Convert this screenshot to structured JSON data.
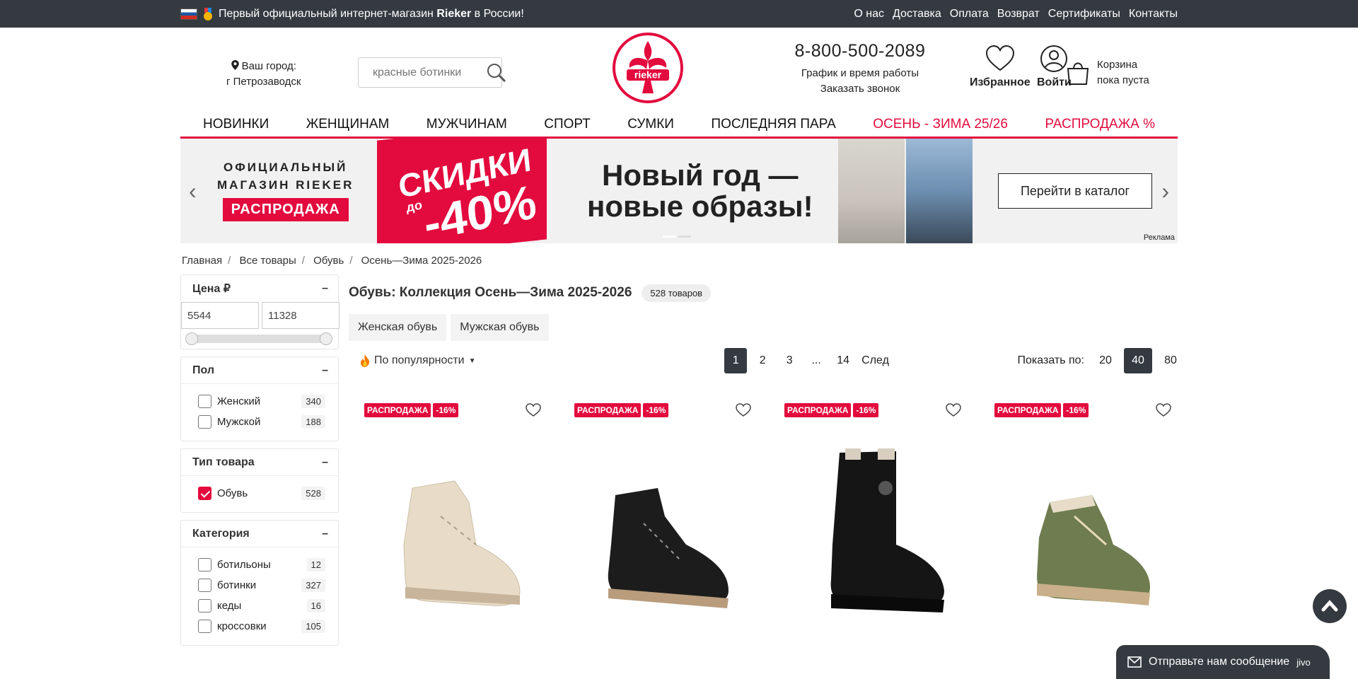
{
  "topbar": {
    "announcement_prefix": "Первый официальный интернет-магазин ",
    "announcement_brand": "Rieker",
    "announcement_suffix": " в России!",
    "links": [
      "О нас",
      "Доставка",
      "Оплата",
      "Возврат",
      "Сертификаты",
      "Контакты"
    ]
  },
  "header": {
    "city_label": "Ваш город:",
    "city_value": "г Петрозаводск",
    "search_placeholder": "красные ботинки",
    "logo_text": "rieker",
    "phone": "8-800-500-2089",
    "work_hours": "График и время работы",
    "callback": "Заказать звонок",
    "favorites": "Избранное",
    "login": "Войти",
    "cart_title": "Корзина",
    "cart_status": "пока пуста"
  },
  "nav": [
    "НОВИНКИ",
    "ЖЕНЩИНАМ",
    "МУЖЧИНАМ",
    "СПОРТ",
    "СУМКИ",
    "ПОСЛЕДНЯЯ ПАРА",
    "ОСЕНЬ - ЗИМА 25/26",
    "РАСПРОДАЖА %"
  ],
  "banner": {
    "line1": "ОФИЦИАЛЬНЫЙ",
    "line2": "МАГАЗИН RIEKER",
    "sale": "РАСПРОДАЖА",
    "discount_word": "СКИДКИ",
    "discount_prefix": "до",
    "discount_value": "-40%",
    "headline1": "Новый год —",
    "headline2": "новые образы!",
    "cta": "Перейти в каталог",
    "ad_label": "Реклама"
  },
  "breadcrumbs": [
    "Главная",
    "Все товары",
    "Обувь",
    "Осень—Зима 2025-2026"
  ],
  "filters": {
    "price": {
      "title": "Цена ₽",
      "min": "5544",
      "max": "11328"
    },
    "gender": {
      "title": "Пол",
      "items": [
        {
          "label": "Женский",
          "count": "340"
        },
        {
          "label": "Мужской",
          "count": "188"
        }
      ]
    },
    "type": {
      "title": "Тип товара",
      "items": [
        {
          "label": "Обувь",
          "count": "528"
        }
      ]
    },
    "category": {
      "title": "Категория",
      "items": [
        {
          "label": "ботильоны",
          "count": "12"
        },
        {
          "label": "ботинки",
          "count": "327"
        },
        {
          "label": "кеды",
          "count": "16"
        },
        {
          "label": "кроссовки",
          "count": "105"
        }
      ]
    }
  },
  "catalog": {
    "title": "Обувь: Коллекция Осень—Зима 2025-2026",
    "count": "528 товаров",
    "chips": [
      "Женская обувь",
      "Мужская обувь"
    ],
    "sort": "По популярности",
    "pages": [
      "1",
      "2",
      "3",
      "...",
      "14",
      "След"
    ],
    "per_page_label": "Показать по:",
    "per_page": [
      "20",
      "40",
      "80"
    ]
  },
  "products": [
    {
      "tag": "РАСПРОДАЖА",
      "discount": "-16%",
      "color": "#e8dcc8"
    },
    {
      "tag": "РАСПРОДАЖА",
      "discount": "-16%",
      "color": "#1c1c1c"
    },
    {
      "tag": "РАСПРОДАЖА",
      "discount": "-16%",
      "color": "#151515"
    },
    {
      "tag": "РАСПРОДАЖА",
      "discount": "-16%",
      "color": "#6f7c4f"
    }
  ],
  "chat": {
    "label": "Отправьте нам сообщение",
    "brand": "jivo"
  },
  "colors": {
    "accent": "#e30b3e",
    "dark": "#343a40"
  }
}
